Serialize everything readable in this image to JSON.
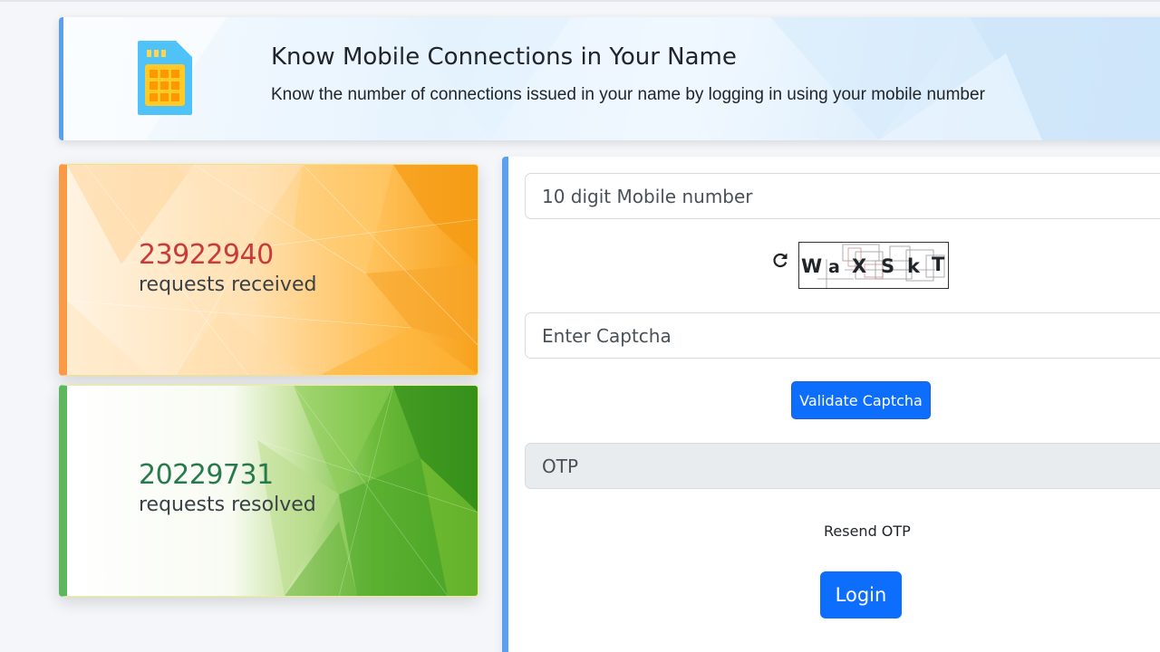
{
  "banner": {
    "title": "Know Mobile Connections in Your Name",
    "subtitle": "Know the number of connections issued in your name by logging in using your mobile number",
    "icon": "sim-card-icon"
  },
  "stats": {
    "received": {
      "value": "23922940",
      "label": "requests received",
      "accent": "#fb9a46",
      "value_color": "#c83b3b"
    },
    "resolved": {
      "value": "20229731",
      "label": "requests resolved",
      "accent": "#5cb85c",
      "value_color": "#287a4d"
    }
  },
  "login": {
    "mobile_placeholder": "10 digit Mobile number",
    "captcha_text": [
      "W",
      "a",
      "X",
      "S",
      "k",
      "T"
    ],
    "refresh_icon": "refresh-icon",
    "captcha_placeholder": "Enter Captcha",
    "validate_label": "Validate Captcha",
    "otp_placeholder": "OTP",
    "resend_label": "Resend OTP",
    "login_label": "Login"
  },
  "colors": {
    "primary": "#0d6efd",
    "panel_accent": "#5b9ff0"
  }
}
